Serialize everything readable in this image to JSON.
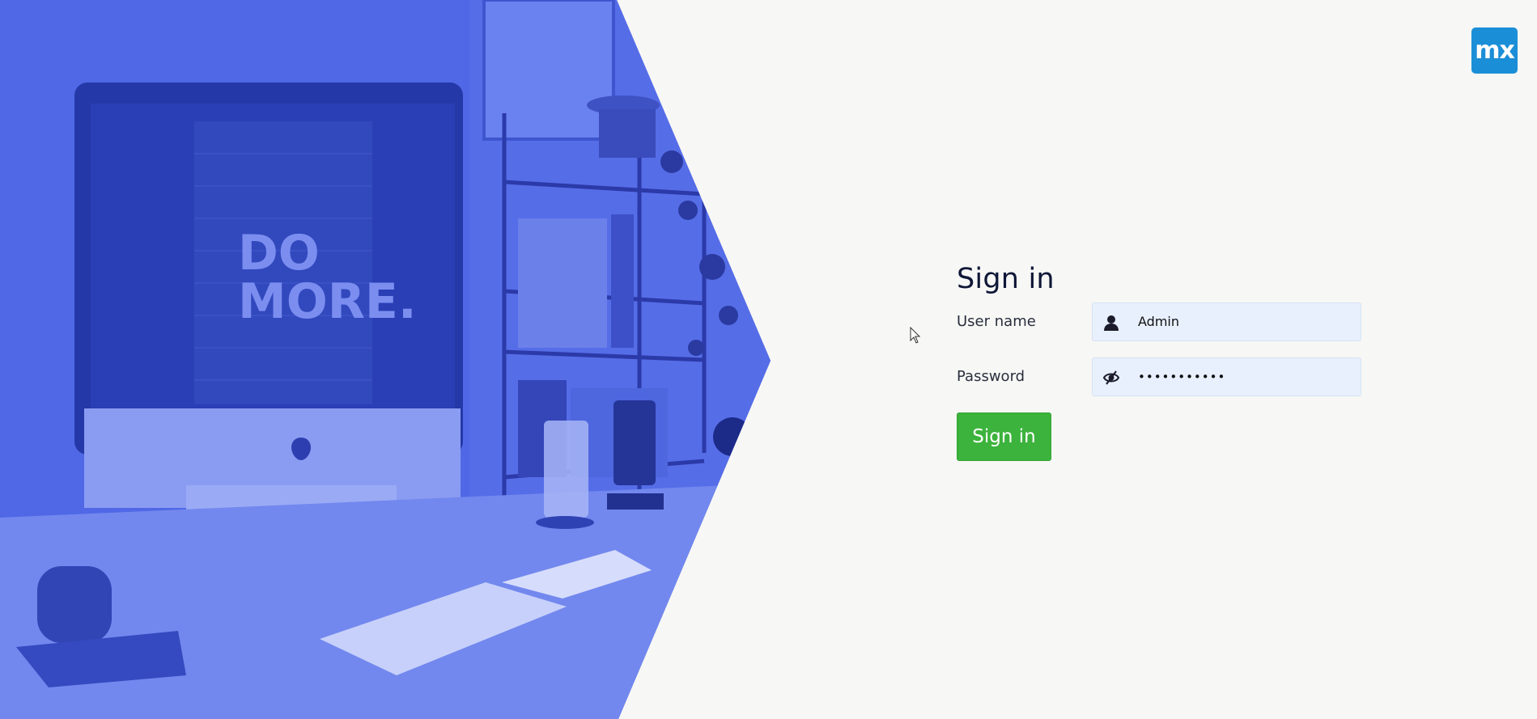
{
  "hero": {
    "poster_text_line1": "DO",
    "poster_text_line2": "MORE."
  },
  "logo": {
    "text": "mx",
    "color": "#1b8ed8"
  },
  "form": {
    "title": "Sign in",
    "username": {
      "label": "User name",
      "value": "Admin",
      "icon": "user-icon"
    },
    "password": {
      "label": "Password",
      "value": "•••••••••••",
      "icon": "eye-slash-icon"
    },
    "submit_label": "Sign in"
  },
  "colors": {
    "background": "#f7f7f5",
    "hero_blue": "#4a62e4",
    "button_green": "#3cb33c",
    "field_bg": "#e8f0fe",
    "title_text": "#0f1737"
  }
}
